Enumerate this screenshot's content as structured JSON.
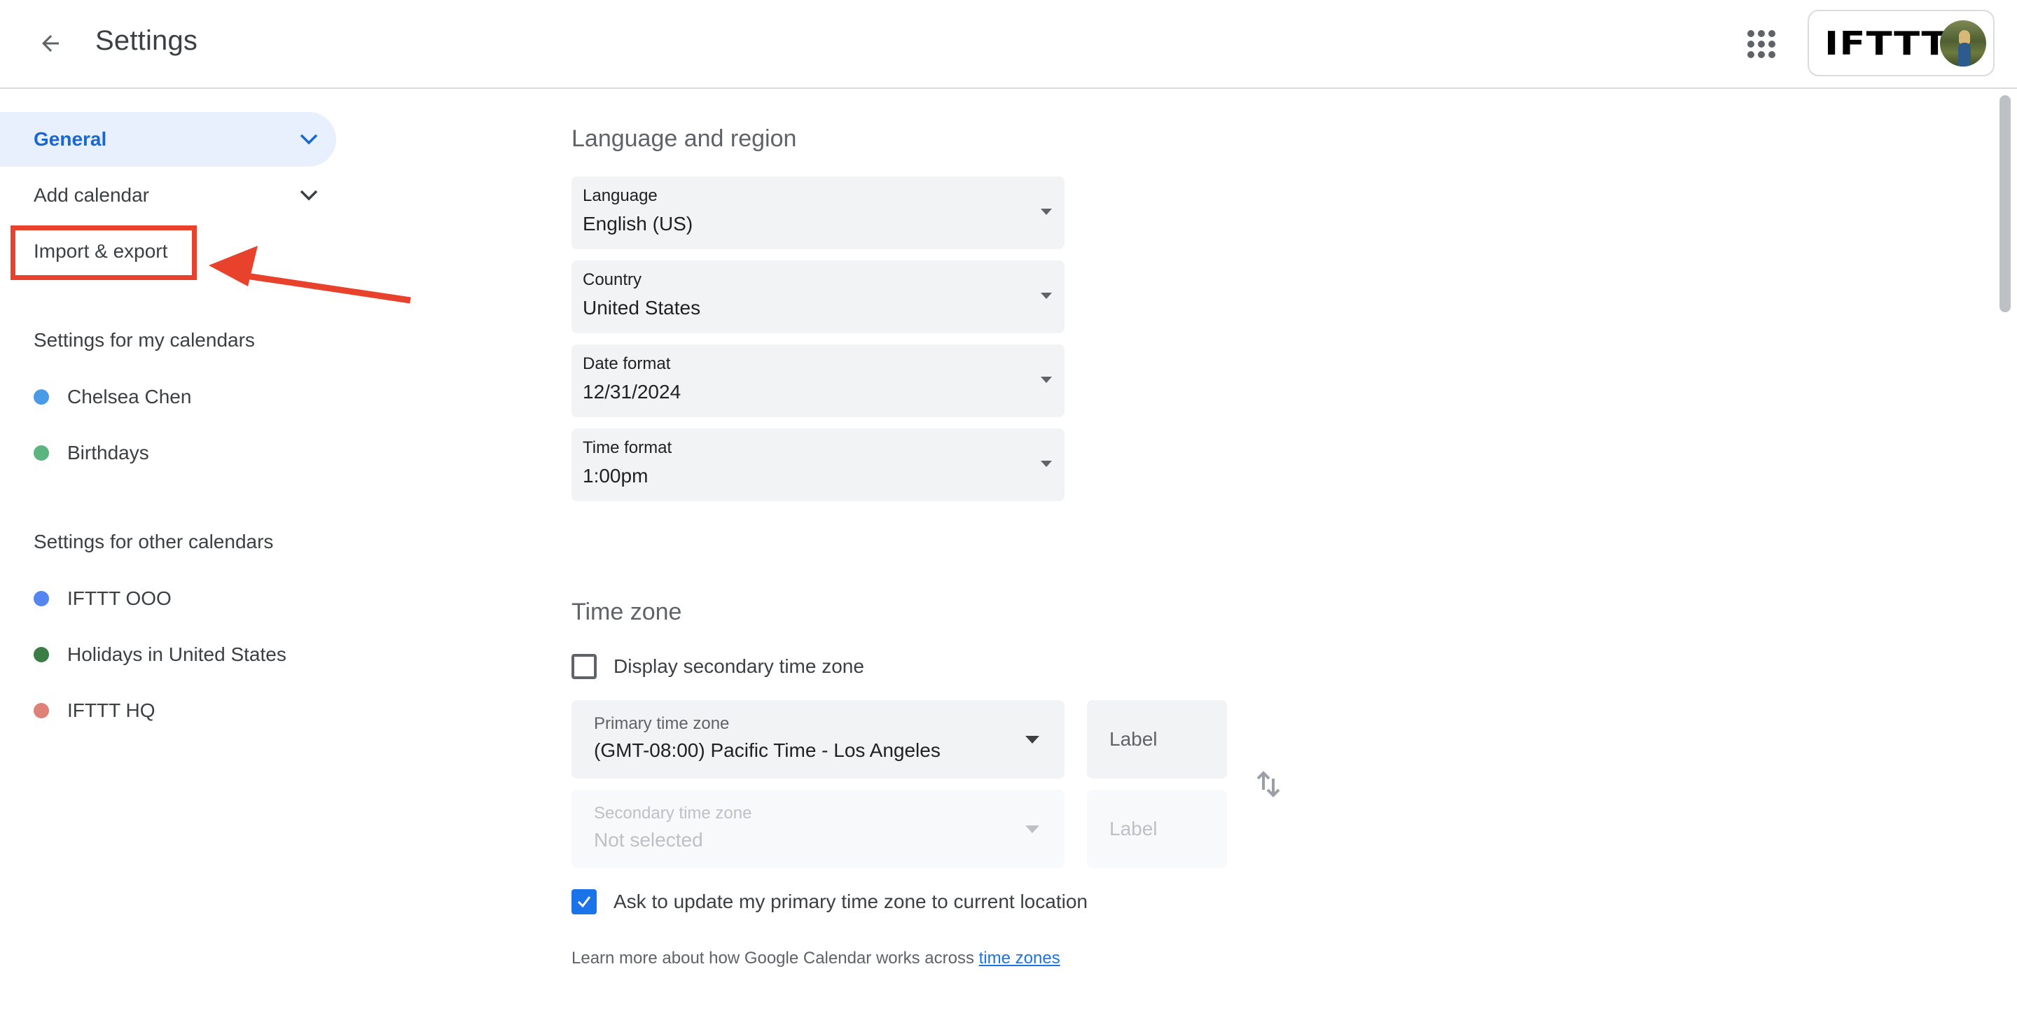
{
  "header": {
    "title": "Settings",
    "back_icon": "arrow-back-icon",
    "apps_icon": "apps-grid-icon",
    "account": {
      "brand_logo": "IFTTT",
      "avatar": "user-avatar-photo"
    }
  },
  "sidebar": {
    "nav": [
      {
        "label": "General",
        "active": true,
        "icon": "chevron-down-icon"
      },
      {
        "label": "Add calendar",
        "active": false,
        "icon": "chevron-down-icon"
      },
      {
        "label": "Import & export",
        "active": false,
        "highlighted": true
      }
    ],
    "my_calendars": {
      "heading": "Settings for my calendars",
      "items": [
        {
          "label": "Chelsea Chen",
          "color": "#4a9be6"
        },
        {
          "label": "Birthdays",
          "color": "#5cb57e"
        }
      ]
    },
    "other_calendars": {
      "heading": "Settings for other calendars",
      "items": [
        {
          "label": "IFTTT OOO",
          "color": "#5485f0"
        },
        {
          "label": "Holidays in United States",
          "color": "#3a7d45"
        },
        {
          "label": "IFTTT HQ",
          "color": "#de8176"
        }
      ]
    }
  },
  "annotation": {
    "color": "#e8412c",
    "target": "Import & export"
  },
  "language_region": {
    "title": "Language and region",
    "fields": [
      {
        "label": "Language",
        "value": "English (US)"
      },
      {
        "label": "Country",
        "value": "United States"
      },
      {
        "label": "Date format",
        "value": "12/31/2024"
      },
      {
        "label": "Time format",
        "value": "1:00pm"
      }
    ]
  },
  "time_zone": {
    "title": "Time zone",
    "display_secondary": {
      "label": "Display secondary time zone",
      "checked": false
    },
    "primary": {
      "label": "Primary time zone",
      "value": "(GMT-08:00) Pacific Time - Los Angeles",
      "label_placeholder": "Label"
    },
    "secondary": {
      "label": "Secondary time zone",
      "value": "Not selected",
      "label_placeholder": "Label",
      "disabled": true
    },
    "swap_icon": "swap-vertical-icon",
    "ask_update": {
      "label": "Ask to update my primary time zone to current location",
      "checked": true
    },
    "help_text": "Learn more about how Google Calendar works across ",
    "help_link": "time zones"
  },
  "colors": {
    "accent": "#1a73e8",
    "active_nav_bg": "#e8f0fe",
    "active_nav_text": "#1967d2",
    "field_bg": "#f1f3f4"
  }
}
